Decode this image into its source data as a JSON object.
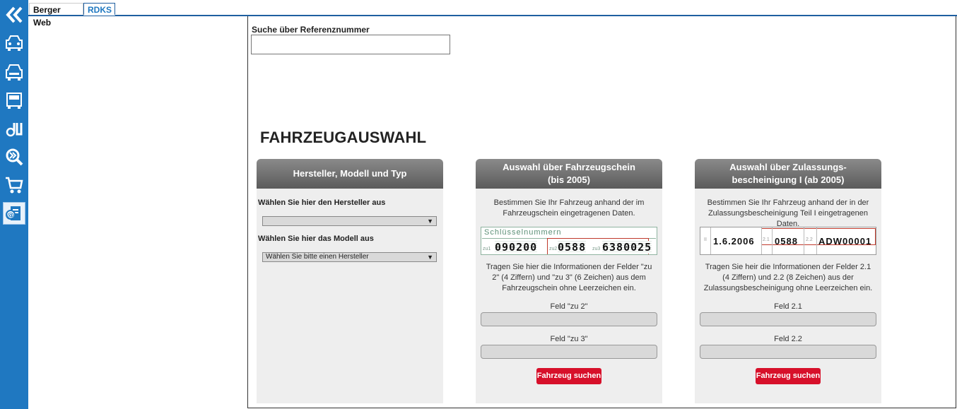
{
  "tabs": [
    {
      "label": "Berger Web"
    },
    {
      "label": "RDKS"
    }
  ],
  "sidebar": {
    "items": [
      {
        "icon": "double-chevron-left-icon"
      },
      {
        "icon": "car-icon"
      },
      {
        "icon": "car-front-icon"
      },
      {
        "icon": "van-icon"
      },
      {
        "icon": "tools-icon"
      },
      {
        "icon": "search-forward-icon"
      },
      {
        "icon": "cart-icon"
      },
      {
        "icon": "document-at-icon"
      }
    ]
  },
  "search": {
    "label": "Suche über Referenznummer",
    "value": "",
    "placeholder": ""
  },
  "page": {
    "title": "FAHRZEUGAUSWAHL"
  },
  "panel1": {
    "title": "Hersteller, Modell und Typ",
    "maker_label": "Wählen Sie hier den Hersteller aus",
    "maker_value": "",
    "model_label": "Wählen Sie hier das Modell aus",
    "model_value": "Wählen Sie bitte einen Hersteller"
  },
  "panel2": {
    "title": "Auswahl über Fahrzeugschein\n(bis 2005)",
    "desc": "Bestimmen Sie Ihr Fahrzeug anhand der im Fahrzeugschein eingetragenen Daten.",
    "doc": {
      "header": "Schlüsselnummern",
      "zu1_label": "zu1",
      "zu1_value": "090200",
      "zu2_label": "zu2",
      "zu2_value": "0588",
      "zu3_label": "zu3",
      "zu3_value": "6380025"
    },
    "info": "Tragen Sie hier die Informationen der Felder \"zu 2\" (4 Ziffern) und \"zu 3\" (6 Zeichen) aus dem Fahrzeugschein ohne Leerzeichen ein.",
    "field1_label": "Feld \"zu 2\"",
    "field2_label": "Feld \"zu 3\"",
    "button": "Fahrzeug suchen"
  },
  "panel3": {
    "title": "Auswahl über Zulassungs-\nbescheinigung I (ab 2005)",
    "desc": "Bestimmen Sie Ihr Fahrzeug anhand der in der Zulassungsbescheinigung Teil I eingetragenen Daten.",
    "doc": {
      "roman": "II",
      "date": "1.6.2006",
      "f21_label": "2.1",
      "f21_value": "0588",
      "f22_label": "2.2",
      "f22_value": "ADW00001"
    },
    "info": "Tragen Sie heir die Informationen der Felder 2.1 (4 Ziffern) und 2.2 (8 Zeichen) aus der Zulassungsbescheinigung ohne Leerzeichen ein.",
    "field1_label": "Feld 2.1",
    "field2_label": "Feld 2.2",
    "button": "Fahrzeug suchen"
  },
  "colors": {
    "sidebar": "#1f78c1",
    "accent_button": "#d7102a",
    "panel_header": "#6b6b6b"
  }
}
